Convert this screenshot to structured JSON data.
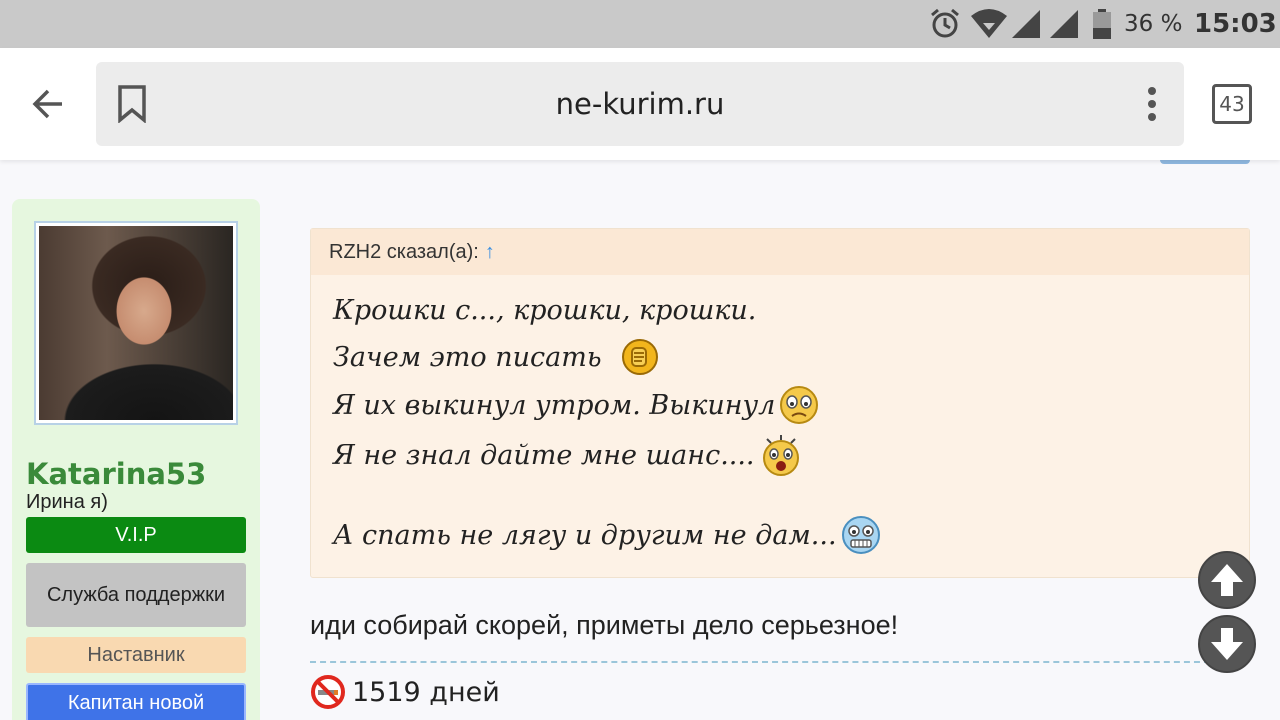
{
  "status_bar": {
    "battery_percent": "36 %",
    "time": "15:03"
  },
  "browser": {
    "url": "ne-kurim.ru",
    "tab_count": "43"
  },
  "sidebar": {
    "username": "Katarina53",
    "subtitle": "Ирина я)",
    "badges": {
      "vip": "V.I.P",
      "support": "Служба поддержки",
      "mentor": "Наставник",
      "captain": "Капитан новой"
    }
  },
  "post": {
    "quote": {
      "header": "RZH2 сказал(а):",
      "arrow": "↑",
      "lines": [
        "Крошки с..., крошки, крошки.",
        "Зачем это писать",
        "Я их выкинул утром. Выкинул",
        "Я не знал дайте мне шанс....",
        "А спать не лягу и другим не дам..."
      ]
    },
    "reply": "иди собирай скорей, приметы дело серьезное!",
    "days_counter": "1519 дней"
  },
  "icons": {
    "alarm": "alarm-icon",
    "wifi": "wifi-icon",
    "signal": "signal-icon",
    "battery": "battery-icon",
    "back": "arrow-back-icon",
    "bookmark": "bookmark-icon",
    "menu": "more-vert-icon",
    "scroll_up": "arrow-up-icon",
    "scroll_down": "arrow-down-icon",
    "no_smoking": "no-smoking-icon"
  },
  "colors": {
    "username": "#3a8a3a",
    "vip_badge": "#0b8a12",
    "support_badge": "#c3c3c3",
    "mentor_badge": "#f9d9b1",
    "captain_badge": "#3f73e8",
    "quote_background": "#fdf2e6",
    "sidebar_background": "#e6f7df"
  }
}
